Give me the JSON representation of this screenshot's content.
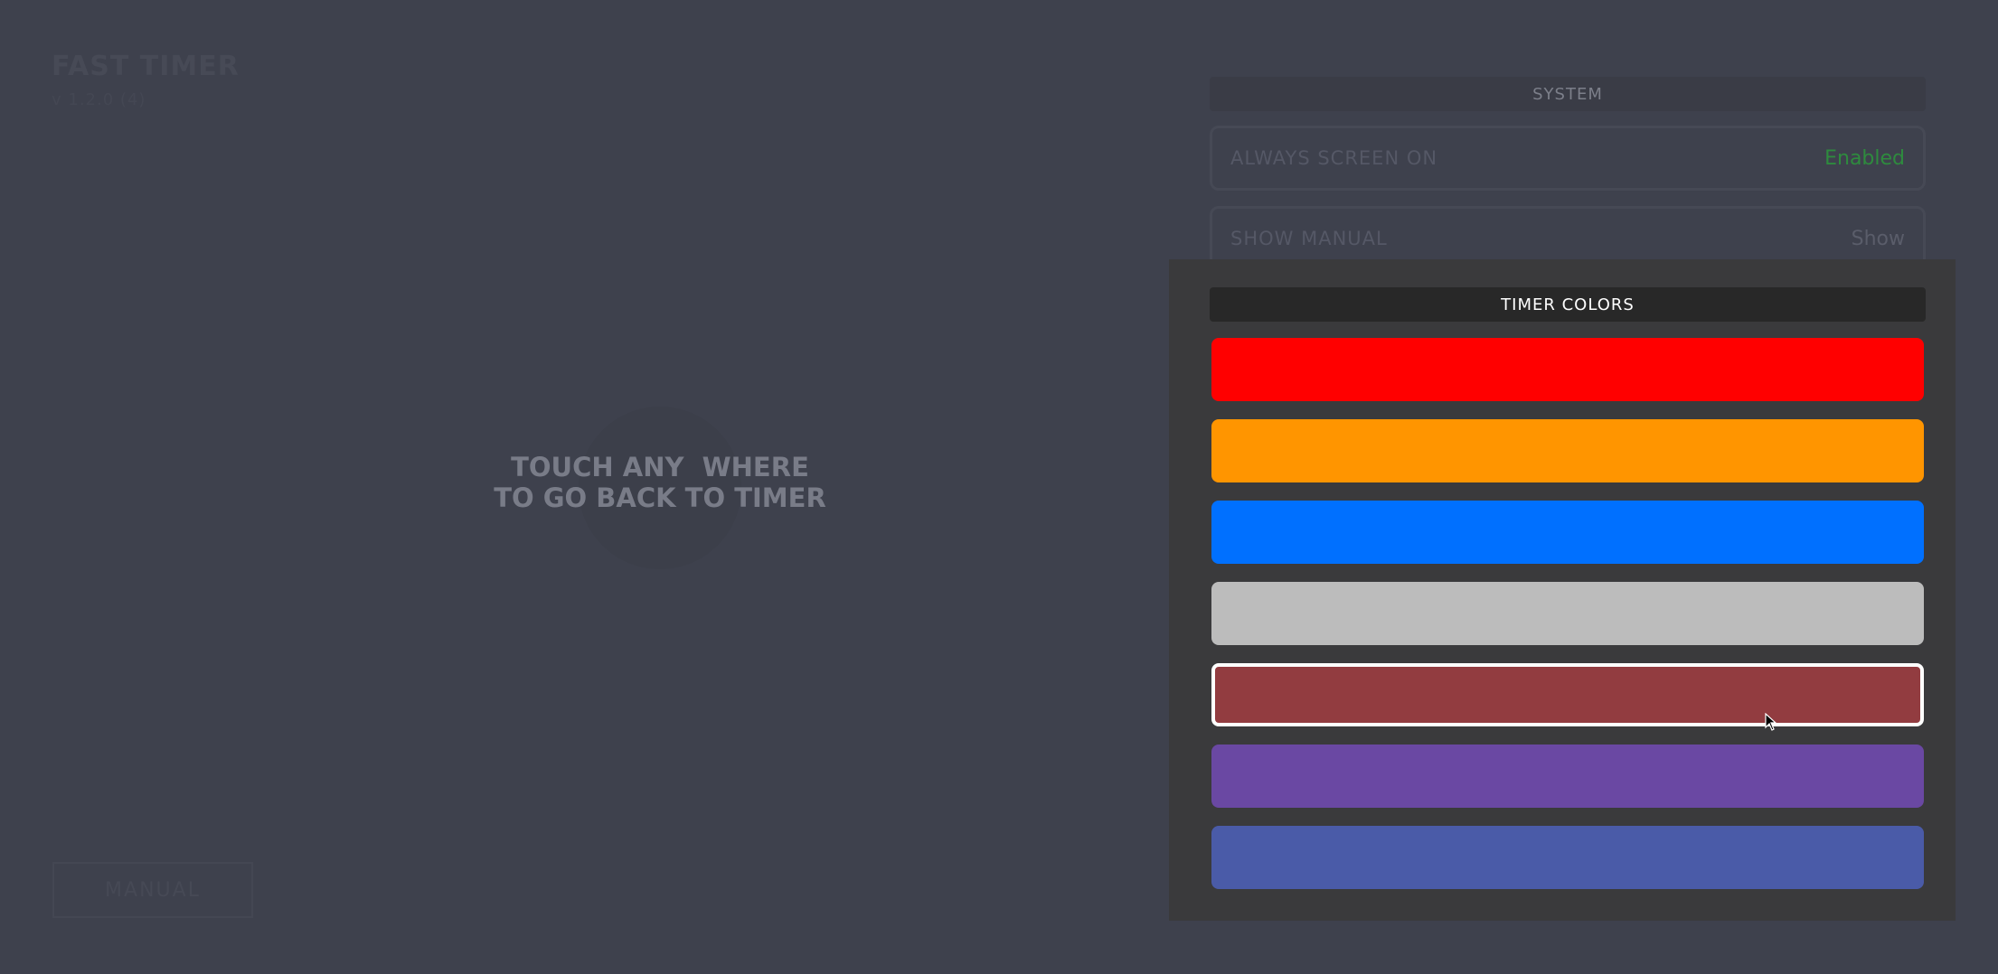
{
  "app": {
    "title": "FAST TIMER",
    "subtitle": "v 1.2.0 (4)",
    "manual_button": "MANUAL"
  },
  "overlay": {
    "hint": "TOUCH ANY  WHERE\nTO GO BACK TO TIMER"
  },
  "system": {
    "header": "SYSTEM",
    "always_screen_on": {
      "label": "ALWAYS SCREEN ON",
      "value": "Enabled"
    },
    "show_manual": {
      "label": "SHOW MANUAL",
      "value": "Show"
    }
  },
  "timer_colors": {
    "header": "TIMER COLORS",
    "selected_index": 4,
    "swatches": [
      {
        "name": "red",
        "color": "#ff0000"
      },
      {
        "name": "orange",
        "color": "#ff9500"
      },
      {
        "name": "blue",
        "color": "#0070ff"
      },
      {
        "name": "silver",
        "color": "#bcbcbc"
      },
      {
        "name": "dark-red",
        "color": "#923c40"
      },
      {
        "name": "purple",
        "color": "#6a48a3"
      },
      {
        "name": "indigo",
        "color": "#4a5ba8"
      }
    ]
  }
}
